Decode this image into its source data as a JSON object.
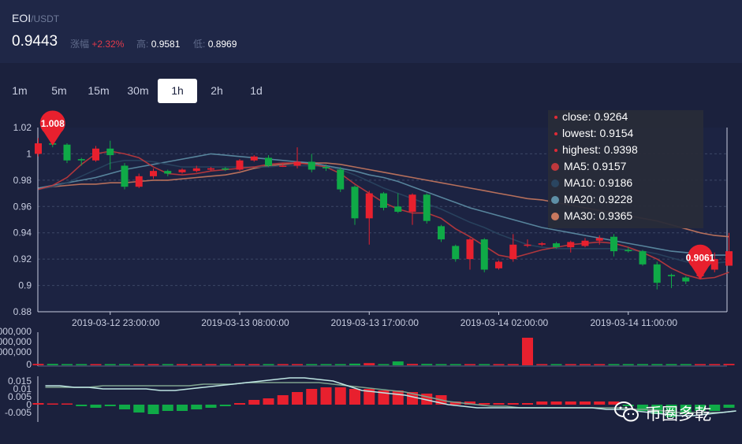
{
  "header": {
    "base": "EOI",
    "sep": "/",
    "quote": "USDT",
    "price": "0.9443",
    "change_label": "涨幅",
    "change_value": "+2.32%",
    "high_label": "高:",
    "high_value": "0.9581",
    "low_label": "低:",
    "low_value": "0.8969"
  },
  "tabs": [
    {
      "label": "1m"
    },
    {
      "label": "5m"
    },
    {
      "label": "15m"
    },
    {
      "label": "30m"
    },
    {
      "label": "1h",
      "active": true
    },
    {
      "label": "2h"
    },
    {
      "label": "1d"
    }
  ],
  "tooltip": {
    "close": "close: 0.9264",
    "lowest": "lowest: 0.9154",
    "highest": "highest: 0.9398",
    "ma5": "MA5: 0.9157",
    "ma10": "MA10: 0.9186",
    "ma20": "MA20: 0.9228",
    "ma30": "MA30: 0.9365"
  },
  "colors": {
    "up": "#e8202e",
    "down": "#0faa47",
    "ma5": "#c0383c",
    "ma10": "#2a4560",
    "ma20": "#5e8fa6",
    "ma30": "#c8785e",
    "dif": "#bfe6e3",
    "dea": "#7fa38e"
  },
  "markers": {
    "max": "1.008",
    "min": "0.9061"
  },
  "watermark": "币圈多乾",
  "chart_data": {
    "type": "candlestick",
    "ylim": [
      0.88,
      1.02
    ],
    "y_ticks": [
      "1.02",
      "1",
      "0.98",
      "0.96",
      "0.94",
      "0.92",
      "0.9",
      "0.88"
    ],
    "x_labels": [
      "2019-03-12 23:00:00",
      "2019-03-13 08:00:00",
      "2019-03-13 17:00:00",
      "2019-03-14 02:00:00",
      "2019-03-14 11:00:00"
    ],
    "x_label_index": [
      5,
      14,
      23,
      32,
      41
    ],
    "candles": [
      {
        "o": 1.0,
        "c": 1.008,
        "h": 1.012,
        "l": 0.998
      },
      {
        "o": 1.008,
        "c": 1.007,
        "h": 1.01,
        "l": 1.005
      },
      {
        "o": 1.007,
        "c": 0.995,
        "h": 1.008,
        "l": 0.993
      },
      {
        "o": 0.996,
        "c": 0.995,
        "h": 0.997,
        "l": 0.991
      },
      {
        "o": 0.995,
        "c": 1.004,
        "h": 1.006,
        "l": 0.994
      },
      {
        "o": 1.004,
        "c": 0.999,
        "h": 1.01,
        "l": 0.988
      },
      {
        "o": 0.991,
        "c": 0.975,
        "h": 0.993,
        "l": 0.973
      },
      {
        "o": 0.975,
        "c": 0.983,
        "h": 0.985,
        "l": 0.974
      },
      {
        "o": 0.983,
        "c": 0.987,
        "h": 0.989,
        "l": 0.981
      },
      {
        "o": 0.987,
        "c": 0.985,
        "h": 0.988,
        "l": 0.983
      },
      {
        "o": 0.986,
        "c": 0.988,
        "h": 0.989,
        "l": 0.985
      },
      {
        "o": 0.987,
        "c": 0.989,
        "h": 0.991,
        "l": 0.986
      },
      {
        "o": 0.988,
        "c": 0.989,
        "h": 0.99,
        "l": 0.987
      },
      {
        "o": 0.989,
        "c": 0.988,
        "h": 0.99,
        "l": 0.987
      },
      {
        "o": 0.988,
        "c": 0.995,
        "h": 0.996,
        "l": 0.987
      },
      {
        "o": 0.995,
        "c": 0.998,
        "h": 0.999,
        "l": 0.994
      },
      {
        "o": 0.997,
        "c": 0.991,
        "h": 0.999,
        "l": 0.99
      },
      {
        "o": 0.991,
        "c": 0.991,
        "h": 0.993,
        "l": 0.99
      },
      {
        "o": 0.991,
        "c": 0.994,
        "h": 1.005,
        "l": 0.989
      },
      {
        "o": 0.994,
        "c": 0.988,
        "h": 1.0,
        "l": 0.986
      },
      {
        "o": 0.99,
        "c": 0.989,
        "h": 0.992,
        "l": 0.987
      },
      {
        "o": 0.988,
        "c": 0.973,
        "h": 0.99,
        "l": 0.971
      },
      {
        "o": 0.975,
        "c": 0.951,
        "h": 0.976,
        "l": 0.946
      },
      {
        "o": 0.951,
        "c": 0.97,
        "h": 0.972,
        "l": 0.931
      },
      {
        "o": 0.97,
        "c": 0.959,
        "h": 0.971,
        "l": 0.957
      },
      {
        "o": 0.96,
        "c": 0.956,
        "h": 0.97,
        "l": 0.955
      },
      {
        "o": 0.956,
        "c": 0.969,
        "h": 0.97,
        "l": 0.946
      },
      {
        "o": 0.969,
        "c": 0.949,
        "h": 0.97,
        "l": 0.947
      },
      {
        "o": 0.945,
        "c": 0.935,
        "h": 0.946,
        "l": 0.933
      },
      {
        "o": 0.93,
        "c": 0.92,
        "h": 0.931,
        "l": 0.918
      },
      {
        "o": 0.92,
        "c": 0.935,
        "h": 0.936,
        "l": 0.912
      },
      {
        "o": 0.935,
        "c": 0.912,
        "h": 0.936,
        "l": 0.91
      },
      {
        "o": 0.913,
        "c": 0.918,
        "h": 0.919,
        "l": 0.912
      },
      {
        "o": 0.92,
        "c": 0.931,
        "h": 0.939,
        "l": 0.918
      },
      {
        "o": 0.931,
        "c": 0.931,
        "h": 0.935,
        "l": 0.929
      },
      {
        "o": 0.931,
        "c": 0.932,
        "h": 0.933,
        "l": 0.93
      },
      {
        "o": 0.932,
        "c": 0.929,
        "h": 0.933,
        "l": 0.928
      },
      {
        "o": 0.929,
        "c": 0.933,
        "h": 0.934,
        "l": 0.925
      },
      {
        "o": 0.93,
        "c": 0.934,
        "h": 0.936,
        "l": 0.929
      },
      {
        "o": 0.934,
        "c": 0.936,
        "h": 0.938,
        "l": 0.931
      },
      {
        "o": 0.937,
        "c": 0.926,
        "h": 0.939,
        "l": 0.922
      },
      {
        "o": 0.927,
        "c": 0.926,
        "h": 0.929,
        "l": 0.925
      },
      {
        "o": 0.926,
        "c": 0.916,
        "h": 0.927,
        "l": 0.915
      },
      {
        "o": 0.916,
        "c": 0.902,
        "h": 0.918,
        "l": 0.897
      },
      {
        "o": 0.908,
        "c": 0.907,
        "h": 0.909,
        "l": 0.898
      },
      {
        "o": 0.906,
        "c": 0.903,
        "h": 0.907,
        "l": 0.901
      },
      {
        "o": 0.907,
        "c": 0.91,
        "h": 0.912,
        "l": 0.906
      },
      {
        "o": 0.912,
        "c": 0.92,
        "h": 0.925,
        "l": 0.91
      },
      {
        "o": 0.915,
        "c": 0.926,
        "h": 0.94,
        "l": 0.915
      }
    ],
    "ma5": [
      0.973,
      0.976,
      0.982,
      0.992,
      1.0,
      1.002,
      1.0,
      0.997,
      0.99,
      0.985,
      0.984,
      0.985,
      0.987,
      0.988,
      0.989,
      0.99,
      0.992,
      0.993,
      0.993,
      0.992,
      0.99,
      0.985,
      0.977,
      0.97,
      0.963,
      0.958,
      0.955,
      0.955,
      0.951,
      0.943,
      0.937,
      0.93,
      0.923,
      0.921,
      0.924,
      0.927,
      0.929,
      0.931,
      0.932,
      0.933,
      0.932,
      0.929,
      0.925,
      0.92,
      0.913,
      0.908,
      0.905,
      0.906,
      0.91
    ],
    "ma10": [
      0.973,
      0.975,
      0.978,
      0.983,
      0.988,
      0.993,
      0.995,
      0.995,
      0.994,
      0.992,
      0.99,
      0.99,
      0.99,
      0.99,
      0.99,
      0.99,
      0.99,
      0.991,
      0.991,
      0.991,
      0.99,
      0.988,
      0.984,
      0.979,
      0.974,
      0.97,
      0.966,
      0.962,
      0.958,
      0.953,
      0.948,
      0.944,
      0.939,
      0.935,
      0.931,
      0.929,
      0.928,
      0.928,
      0.928,
      0.928,
      0.928,
      0.927,
      0.926,
      0.924,
      0.921,
      0.918,
      0.917,
      0.917,
      0.918
    ],
    "ma20": [
      0.974,
      0.976,
      0.978,
      0.98,
      0.982,
      0.985,
      0.988,
      0.99,
      0.992,
      0.994,
      0.996,
      0.998,
      1.0,
      0.999,
      0.998,
      0.997,
      0.996,
      0.995,
      0.994,
      0.993,
      0.991,
      0.989,
      0.987,
      0.984,
      0.982,
      0.979,
      0.975,
      0.971,
      0.967,
      0.963,
      0.959,
      0.956,
      0.953,
      0.95,
      0.947,
      0.944,
      0.942,
      0.94,
      0.938,
      0.936,
      0.934,
      0.932,
      0.93,
      0.928,
      0.926,
      0.925,
      0.924,
      0.923,
      0.923
    ],
    "ma30": [
      0.974,
      0.975,
      0.976,
      0.977,
      0.977,
      0.978,
      0.978,
      0.979,
      0.98,
      0.98,
      0.981,
      0.982,
      0.983,
      0.984,
      0.986,
      0.989,
      0.991,
      0.992,
      0.993,
      0.993,
      0.993,
      0.992,
      0.99,
      0.988,
      0.986,
      0.984,
      0.982,
      0.98,
      0.978,
      0.976,
      0.974,
      0.972,
      0.97,
      0.968,
      0.966,
      0.965,
      0.963,
      0.961,
      0.959,
      0.957,
      0.955,
      0.953,
      0.951,
      0.949,
      0.946,
      0.943,
      0.94,
      0.938,
      0.937
    ],
    "volume_ticks": [
      "000,000",
      "000,000",
      "000,000",
      "0"
    ],
    "volume": [
      0.05,
      0.05,
      0.04,
      0.03,
      0.03,
      0.02,
      0.04,
      0.02,
      0.02,
      0.02,
      0.02,
      0.02,
      0.02,
      0.02,
      0.02,
      0.02,
      0.02,
      0.02,
      0.02,
      0.02,
      0.03,
      0.04,
      0.06,
      0.08,
      0.04,
      0.14,
      0.05,
      0.05,
      0.03,
      0.02,
      0.02,
      0.03,
      0.03,
      0.02,
      1.0,
      0.03,
      0.02,
      0.02,
      0.02,
      0.02,
      0.02,
      0.02,
      0.02,
      0.02,
      0.03,
      0.02,
      0.03,
      0.02,
      0.05
    ],
    "macd_ticks": [
      "0.015",
      "0.01",
      "0.005",
      "0",
      "-0.005"
    ],
    "macd_ylim": [
      -0.009,
      0.018
    ],
    "macd_hist": [
      0.001,
      0.0,
      0.0,
      -0.001,
      -0.002,
      -0.001,
      -0.003,
      -0.005,
      -0.006,
      -0.004,
      -0.004,
      -0.003,
      -0.002,
      -0.001,
      0.001,
      0.003,
      0.004,
      0.006,
      0.008,
      0.01,
      0.011,
      0.011,
      0.01,
      0.01,
      0.009,
      0.009,
      0.008,
      0.007,
      0.006,
      0.002,
      0.002,
      0.001,
      0.001,
      0.001,
      0.001,
      0.002,
      0.002,
      0.002,
      0.002,
      0.002,
      0.002,
      -0.001,
      -0.004,
      -0.006,
      -0.008,
      -0.006,
      -0.004,
      -0.004,
      -0.002
    ],
    "dif": [
      0.012,
      0.012,
      0.011,
      0.011,
      0.01,
      0.01,
      0.01,
      0.01,
      0.009,
      0.009,
      0.01,
      0.011,
      0.012,
      0.013,
      0.014,
      0.015,
      0.016,
      0.017,
      0.017,
      0.016,
      0.015,
      0.012,
      0.009,
      0.008,
      0.007,
      0.006,
      0.004,
      0.002,
      0.0,
      -0.001,
      -0.002,
      -0.002,
      -0.002,
      -0.002,
      -0.002,
      -0.002,
      -0.002,
      -0.002,
      -0.002,
      -0.003,
      -0.003,
      -0.004,
      -0.005,
      -0.006,
      -0.007,
      -0.007,
      -0.006,
      -0.005,
      -0.004
    ],
    "dea": [
      0.011,
      0.011,
      0.011,
      0.011,
      0.012,
      0.012,
      0.012,
      0.012,
      0.012,
      0.012,
      0.012,
      0.013,
      0.013,
      0.013,
      0.014,
      0.014,
      0.014,
      0.014,
      0.014,
      0.014,
      0.013,
      0.012,
      0.011,
      0.01,
      0.009,
      0.008,
      0.006,
      0.004,
      0.002,
      0.001,
      0.0,
      -0.001,
      -0.001,
      -0.002,
      -0.002,
      -0.002,
      -0.002,
      -0.002,
      -0.002,
      -0.002,
      -0.002,
      -0.003,
      -0.003,
      -0.004,
      -0.005,
      -0.005,
      -0.005,
      -0.005,
      -0.004
    ]
  }
}
